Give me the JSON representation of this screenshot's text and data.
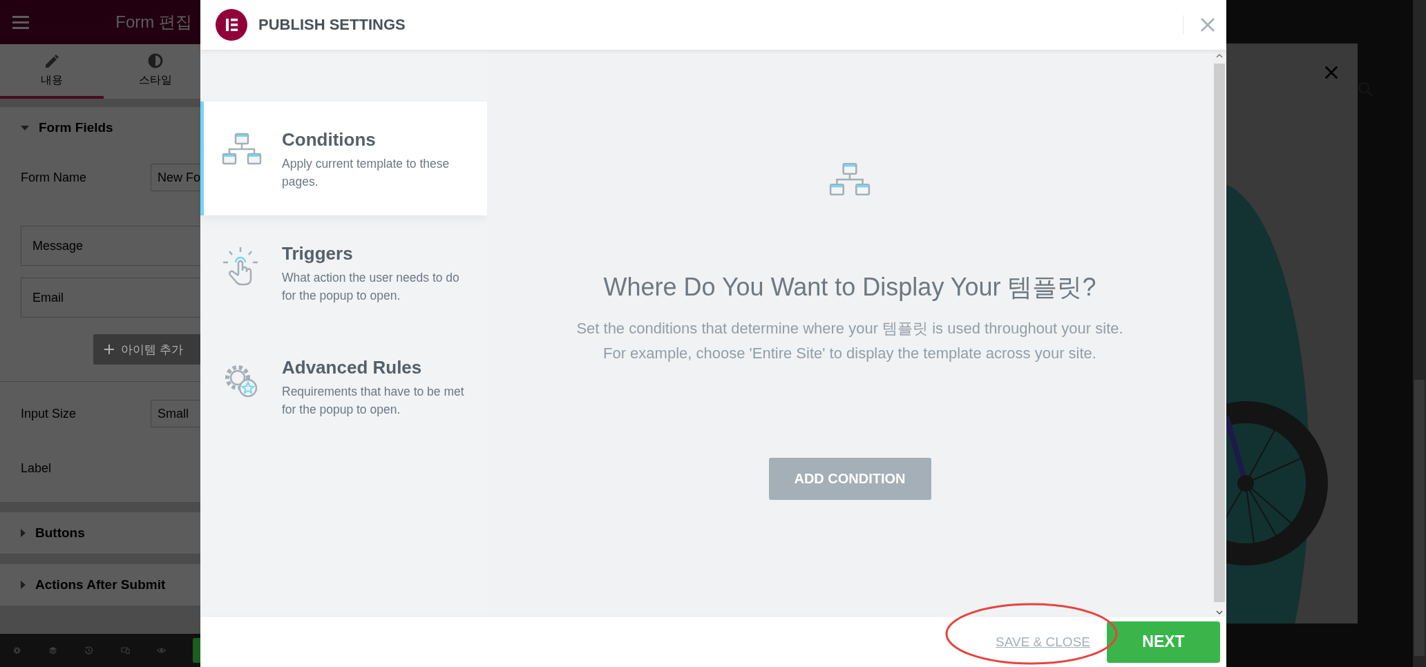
{
  "editor_panel": {
    "title": "Form 편집",
    "tabs": [
      {
        "label": "내용",
        "selected": true,
        "kind": "pencil"
      },
      {
        "label": "스타일",
        "selected": false,
        "kind": "contrast"
      }
    ],
    "form_fields": {
      "title": "Form Fields",
      "expanded": true,
      "form_name": {
        "label": "Form Name",
        "value": "New Fo"
      },
      "items": [
        "Message",
        "Email"
      ],
      "add_item_button": "아이템 추가",
      "input_size": {
        "label": "Input Size",
        "value": "Small"
      },
      "label_row": "Label"
    },
    "sections": [
      {
        "title": "Buttons",
        "expanded": false
      },
      {
        "title": "Actions After Submit",
        "expanded": false
      }
    ]
  },
  "publish_modal": {
    "title": "PUBLISH SETTINGS",
    "steps": [
      {
        "title": "Conditions",
        "description": "Apply current template to these pages.",
        "selected": true,
        "kind": "sitemap"
      },
      {
        "title": "Triggers",
        "description": "What action the user needs to do for the popup to open.",
        "selected": false,
        "kind": "tap"
      },
      {
        "title": "Advanced Rules",
        "description": "Requirements that have to be met for the popup to open.",
        "selected": false,
        "kind": "gear"
      }
    ],
    "content": {
      "heading": "Where Do You Want to Display Your 템플릿?",
      "description": [
        "Set the conditions that determine where your 템플릿 is used throughout your site.",
        "For example, choose 'Entire Site' to display the template across your site."
      ],
      "add_button": "ADD CONDITION"
    },
    "footer": {
      "save_close": "SAVE & CLOSE",
      "next": "NEXT"
    }
  }
}
